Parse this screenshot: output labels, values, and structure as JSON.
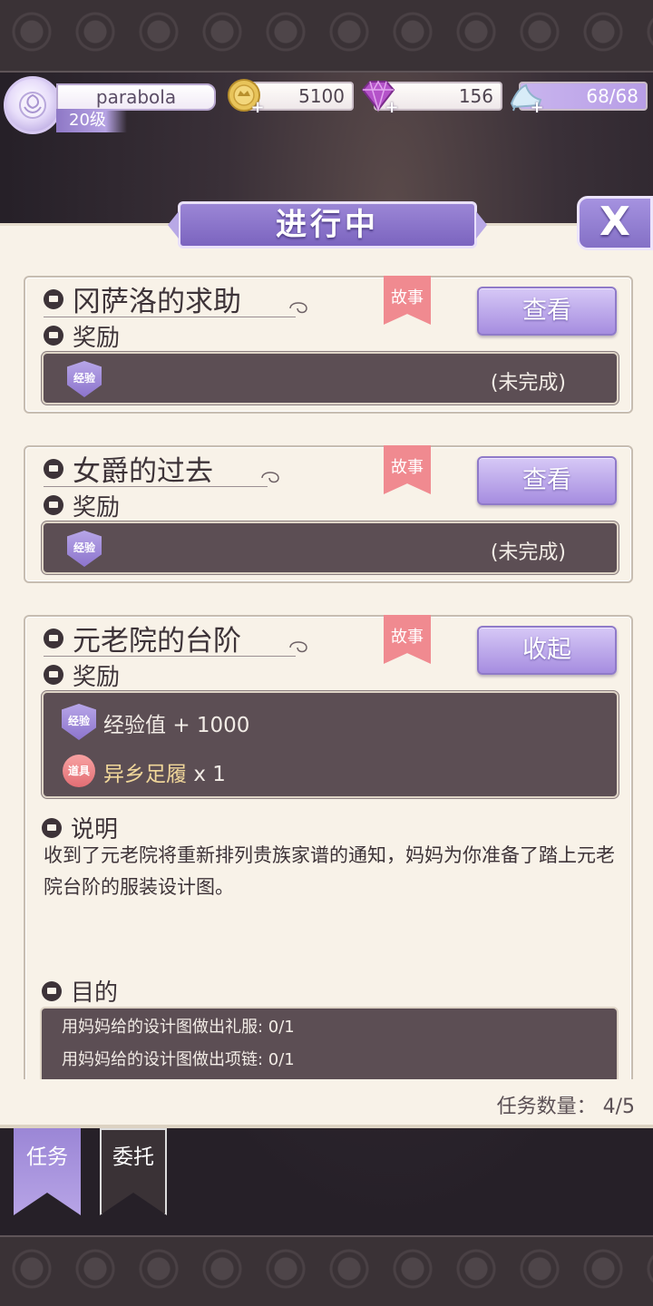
{
  "player": {
    "name": "parabola",
    "level": "20级"
  },
  "resources": {
    "gold": "5100",
    "gems": "156",
    "stamina": "68/68"
  },
  "panel": {
    "title": "进行中",
    "close_label": "X"
  },
  "quests": [
    {
      "title": "冈萨洛的求助",
      "tag": "故事",
      "button": "查看",
      "reward_label": "奖励",
      "badge": "经验",
      "status": "(未完成)"
    },
    {
      "title": "女爵的过去",
      "tag": "故事",
      "button": "查看",
      "reward_label": "奖励",
      "badge": "经验",
      "status": "(未完成)"
    },
    {
      "title": "元老院的台阶",
      "tag": "故事",
      "button": "收起",
      "reward_label": "奖励",
      "rewards": [
        {
          "badge": "经验",
          "name": "经验值",
          "amount": "+ 1000"
        },
        {
          "badge": "道具",
          "name": "异乡足履",
          "amount": "x 1"
        }
      ],
      "description_label": "说明",
      "description": "收到了元老院将重新排列贵族家谱的通知，妈妈为你准备了踏上元老院台阶的服装设计图。",
      "goal_label": "目的",
      "goals": [
        "用妈妈给的设计图做出礼服: 0/1",
        "用妈妈给的设计图做出项链: 0/1"
      ]
    }
  ],
  "footer": {
    "task_count": "任务数量： 4/5"
  },
  "tabs": {
    "tasks": "任务",
    "commission": "委托"
  },
  "colors": {
    "accent_purple": "#8f7ac9",
    "panel_bg": "#f8f2e8",
    "reward_box_bg": "#5c4e54",
    "story_tag": "#f08a90",
    "item_name": "#f1d79a"
  }
}
